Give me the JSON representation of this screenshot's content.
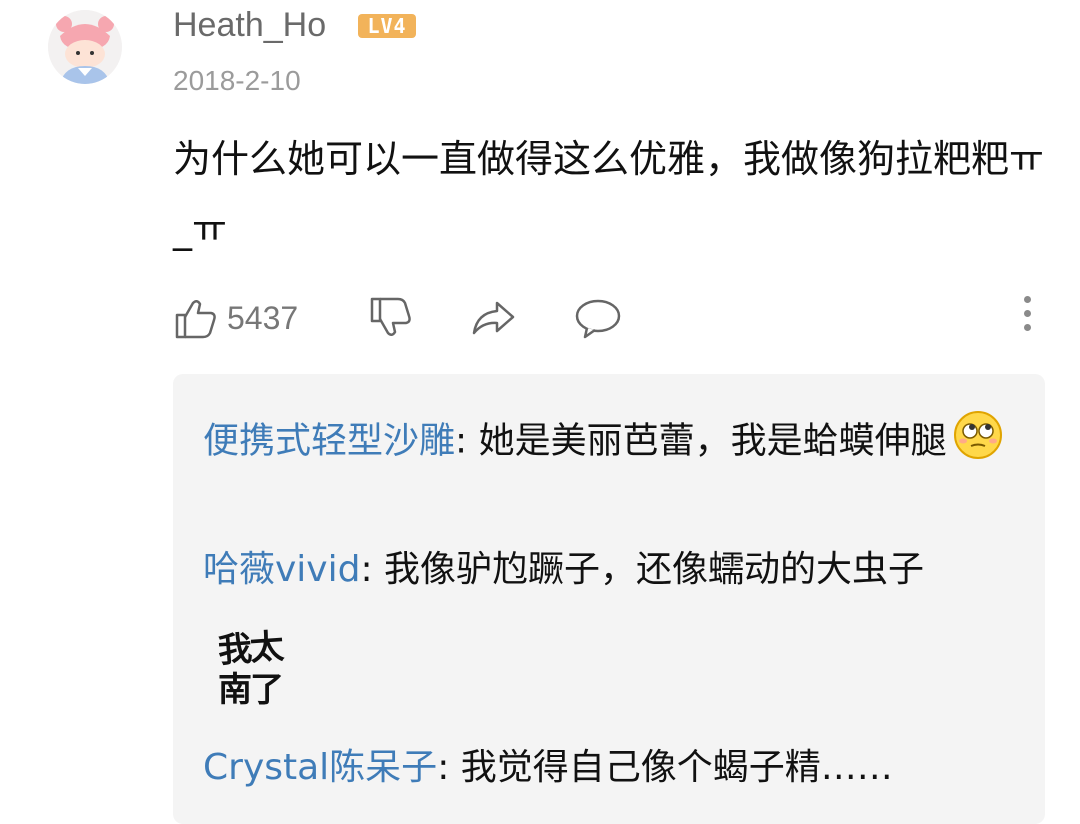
{
  "comment": {
    "username": "Heath_Ho",
    "level": "LV4",
    "date": "2018-2-10",
    "text": "为什么她可以一直做得这么优雅，我做像狗拉粑粑ㅠ_ㅠ",
    "likes": "5437"
  },
  "icons": [
    "thumbs-up-icon",
    "thumbs-down-icon",
    "share-icon",
    "reply-bubble-icon",
    "more-icon",
    "eyes-roll-emoji"
  ],
  "replies": [
    {
      "name": "便携式轻型沙雕",
      "sep": ": ",
      "text": "她是美丽芭蕾，我是蛤蟆伸腿"
    },
    {
      "name": "哈薇vivid",
      "sep": ": ",
      "text": "我像驴尥蹶子，还像蠕动的大虫子"
    },
    {
      "name": "Crystal陈呆子",
      "sep": ": ",
      "text": "我觉得自己像个蝎子精……"
    }
  ],
  "sticker_text": [
    "我太",
    "南了"
  ],
  "colors": {
    "name_link": "#3f7cb8",
    "badge": "#f2b35a",
    "reply_bg": "#f4f4f4"
  }
}
